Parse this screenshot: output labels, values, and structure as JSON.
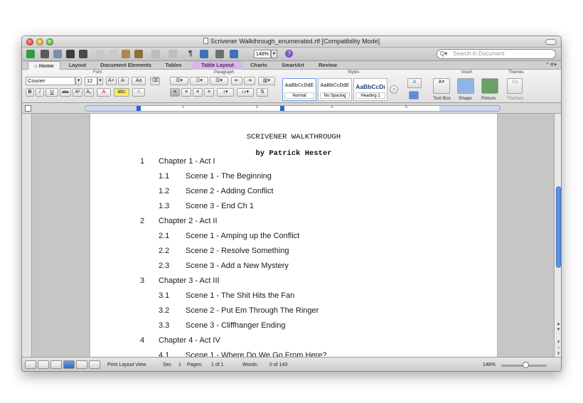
{
  "window": {
    "title": "Scrivener Walkthrough_enumerated.rtf [Compatibility Mode]"
  },
  "toolbar": {
    "zoom_value": "148%",
    "search_placeholder": "Search in Document"
  },
  "tabs": [
    {
      "label": "Home",
      "active": true
    },
    {
      "label": "Layout"
    },
    {
      "label": "Document Elements"
    },
    {
      "label": "Tables"
    },
    {
      "label": "Table Layout",
      "highlight": true
    },
    {
      "label": "Charts"
    },
    {
      "label": "SmartArt"
    },
    {
      "label": "Review"
    }
  ],
  "ribbon": {
    "groups": {
      "font": "Font",
      "paragraph": "Paragraph",
      "styles": "Styles",
      "insert": "Insert",
      "themes": "Themes"
    },
    "font_name": "Courier",
    "font_size": "12",
    "styles": [
      {
        "sample": "AaBbCcDdE",
        "name": "Normal"
      },
      {
        "sample": "AaBbCcDdE",
        "name": "No Spacing"
      },
      {
        "sample": "AaBbCcDı",
        "name": "Heading 1"
      }
    ],
    "insert_items": [
      "Text Box",
      "Shape",
      "Picture"
    ],
    "themes_label": "Themes",
    "accent_color": "#d9b6e6"
  },
  "document": {
    "title": "SCRIVENER WALKTHROUGH",
    "author": "by Patrick Hester",
    "outline": [
      {
        "num": "1",
        "text": "Chapter 1 - Act I",
        "level": 1
      },
      {
        "num": "1.1",
        "text": "Scene 1 - The Beginning",
        "level": 2
      },
      {
        "num": "1.2",
        "text": "Scene 2 - Adding Conflict",
        "level": 2
      },
      {
        "num": "1.3",
        "text": "Scene 3 - End Ch 1",
        "level": 2
      },
      {
        "num": "2",
        "text": "Chapter 2 - Act II",
        "level": 1
      },
      {
        "num": "2.1",
        "text": "Scene 1 - Amping up the Conflict",
        "level": 2
      },
      {
        "num": "2.2",
        "text": "Scene 2 - Resolve Something",
        "level": 2
      },
      {
        "num": "2.3",
        "text": "Scene 3 - Add a New Mystery",
        "level": 2
      },
      {
        "num": "3",
        "text": "Chapter 3 - Act III",
        "level": 1
      },
      {
        "num": "3.1",
        "text": "Scene 1 - The Shit Hits the Fan",
        "level": 2
      },
      {
        "num": "3.2",
        "text": "Scene 2 - Put Em Through The Ringer",
        "level": 2
      },
      {
        "num": "3.3",
        "text": "Scene 3 - Cliffhanger Ending",
        "level": 2
      },
      {
        "num": "4",
        "text": "Chapter 4 - Act IV",
        "level": 1
      },
      {
        "num": "4.1",
        "text": "Scene 1 - Where Do We Go From Here?",
        "level": 2
      }
    ]
  },
  "status": {
    "view_name": "Print Layout View",
    "sec_label": "Sec",
    "sec_value": "1",
    "pages_label": "Pages:",
    "pages_value": "1 of 1",
    "words_label": "Words:",
    "words_value": "0 of 143",
    "zoom": "148%"
  }
}
